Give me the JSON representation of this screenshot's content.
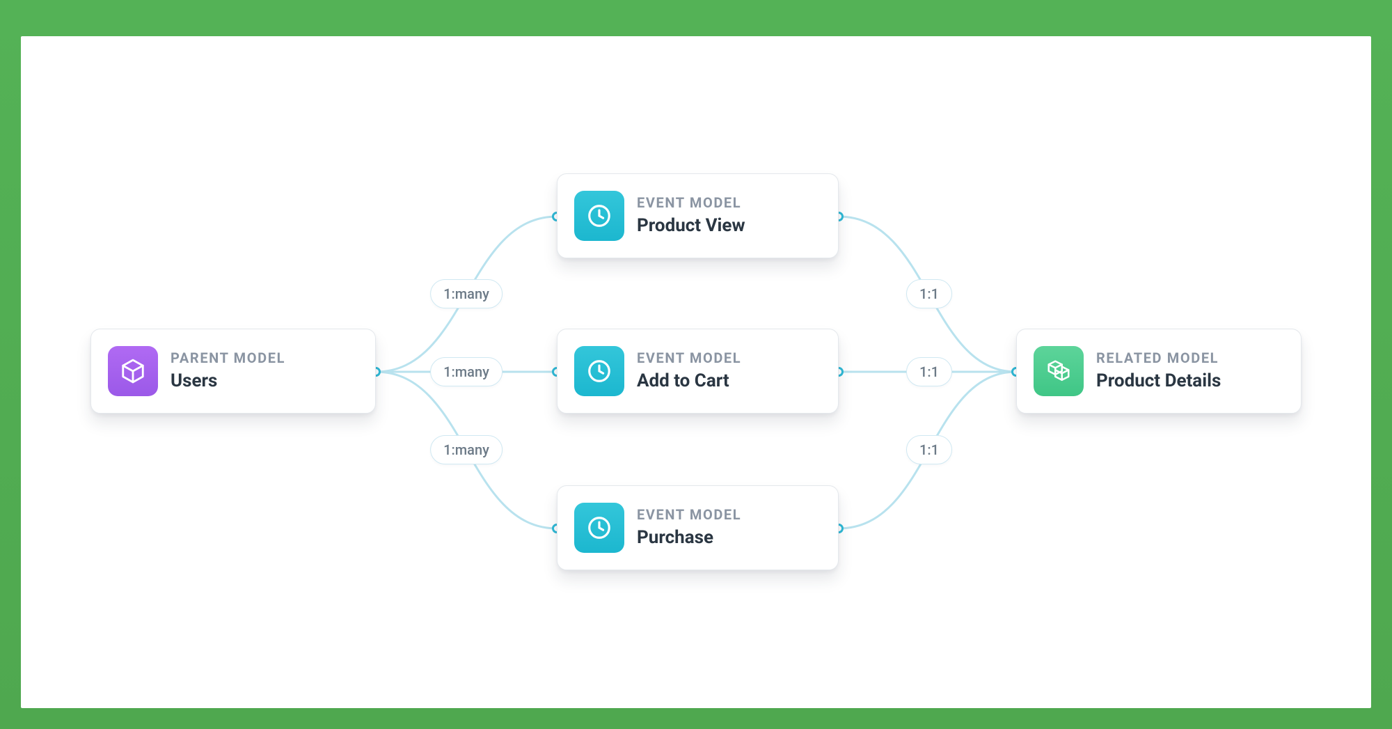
{
  "parent": {
    "eyebrow": "PARENT MODEL",
    "title": "Users"
  },
  "events": [
    {
      "eyebrow": "EVENT MODEL",
      "title": "Product View"
    },
    {
      "eyebrow": "EVENT MODEL",
      "title": "Add to Cart"
    },
    {
      "eyebrow": "EVENT MODEL",
      "title": "Purchase"
    }
  ],
  "related": {
    "eyebrow": "RELATED MODEL",
    "title": "Product Details"
  },
  "rel_left": [
    {
      "label": "1:many"
    },
    {
      "label": "1:many"
    },
    {
      "label": "1:many"
    }
  ],
  "rel_right": [
    {
      "label": "1:1"
    },
    {
      "label": "1:1"
    },
    {
      "label": "1:1"
    }
  ],
  "colors": {
    "connector": "#b8e2ee",
    "port": "#2fb9d6"
  }
}
